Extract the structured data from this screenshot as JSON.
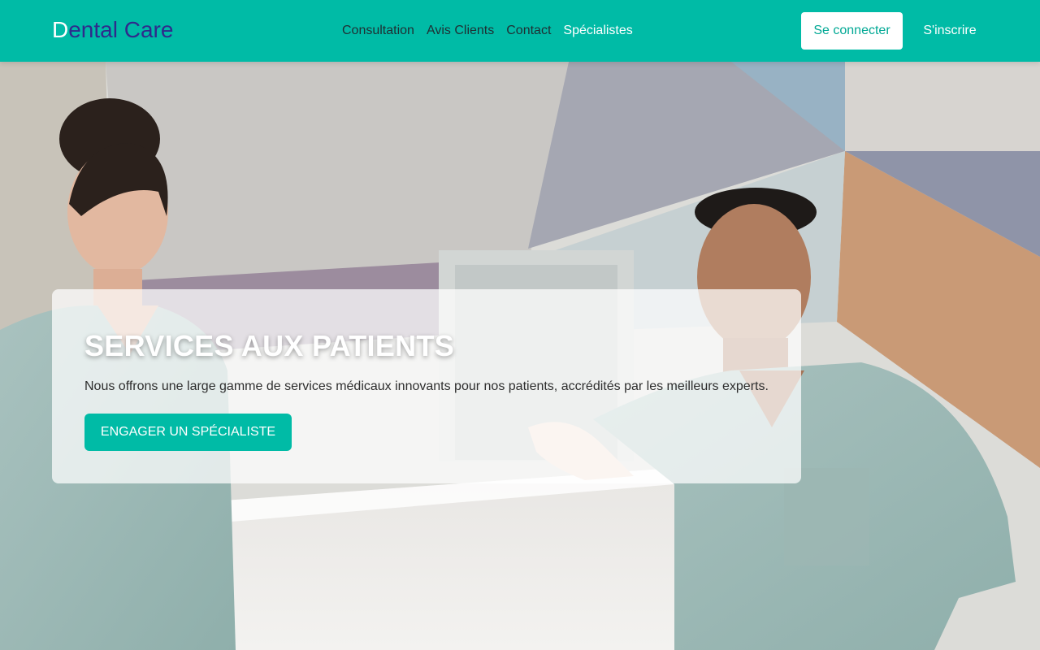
{
  "header": {
    "brand_first_letter": "D",
    "brand_rest": "ental Care",
    "nav": [
      {
        "label": "Consultation"
      },
      {
        "label": "Avis Clients"
      },
      {
        "label": "Contact"
      },
      {
        "label": "Spécialistes"
      }
    ],
    "login_label": "Se connecter",
    "signup_label": "S'inscrire"
  },
  "hero": {
    "title": "SERVICES AUX PATIENTS",
    "description": "Nous offrons une large gamme de services médicaux innovants pour nos patients, accrédités par les meilleurs experts.",
    "cta_label": "ENGAGER UN SPÉCIALISTE"
  },
  "colors": {
    "accent": "#00bba6",
    "brand_text": "#2f2a8c",
    "nav_text": "#1f2f33"
  }
}
